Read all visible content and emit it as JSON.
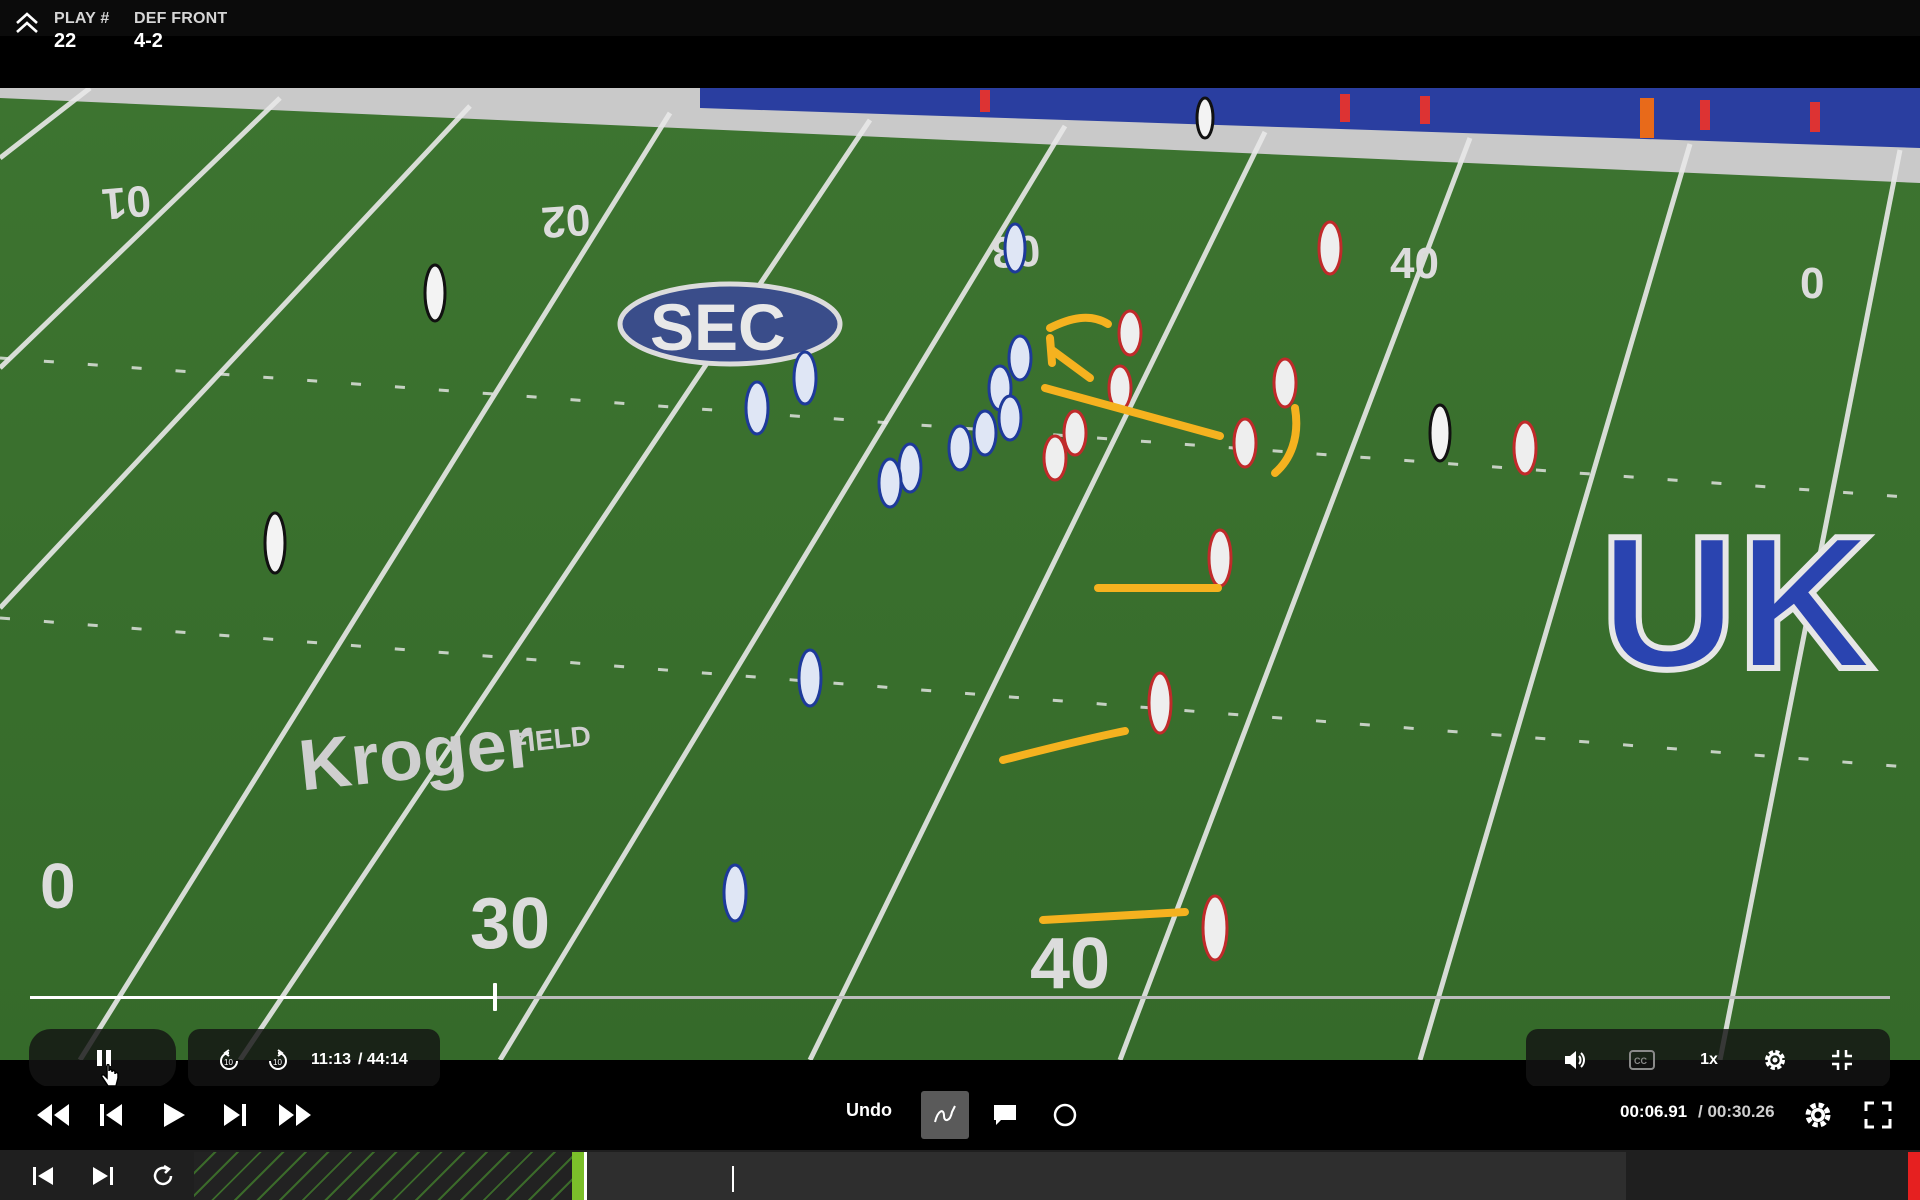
{
  "header": {
    "play_label": "PLAY #",
    "play_value": "22",
    "front_label": "DEF FRONT",
    "front_value": "4-2",
    "collapse_icon": "double-chevron-up-icon"
  },
  "video": {
    "field_numbers": [
      "10",
      "20",
      "30",
      "40",
      "50",
      "0",
      "30",
      "40"
    ],
    "field_logo_text": "SEC",
    "field_sponsor_text": "Kroger",
    "field_sponsor_sub": "FIELD",
    "endzone_text": "UK",
    "annotation_color": "#f5b21f",
    "progress": 0.25
  },
  "player_controls": {
    "current_time": "11:13",
    "total_time": "/ 44:14",
    "rewind_icon": "rewind-10-icon",
    "forward_icon": "forward-10-icon",
    "pause_icon": "pause-icon",
    "speed_label": "1x",
    "volume_icon": "volume-icon",
    "cc_icon": "closed-captions-icon",
    "settings_icon": "gear-icon",
    "fullscreen_icon": "exit-fullscreen-icon"
  },
  "editor": {
    "undo_label": "Undo",
    "tools": [
      "freehand-draw-icon",
      "comment-icon",
      "circle-icon"
    ],
    "clip_time": "00:06.91",
    "clip_total": "/ 00:30.26"
  },
  "transport": [
    "rewind-icon",
    "step-back-icon",
    "play-icon",
    "step-forward-icon",
    "fast-forward-icon"
  ],
  "bottom": [
    "skip-start-icon",
    "skip-end-icon",
    "loop-icon"
  ]
}
